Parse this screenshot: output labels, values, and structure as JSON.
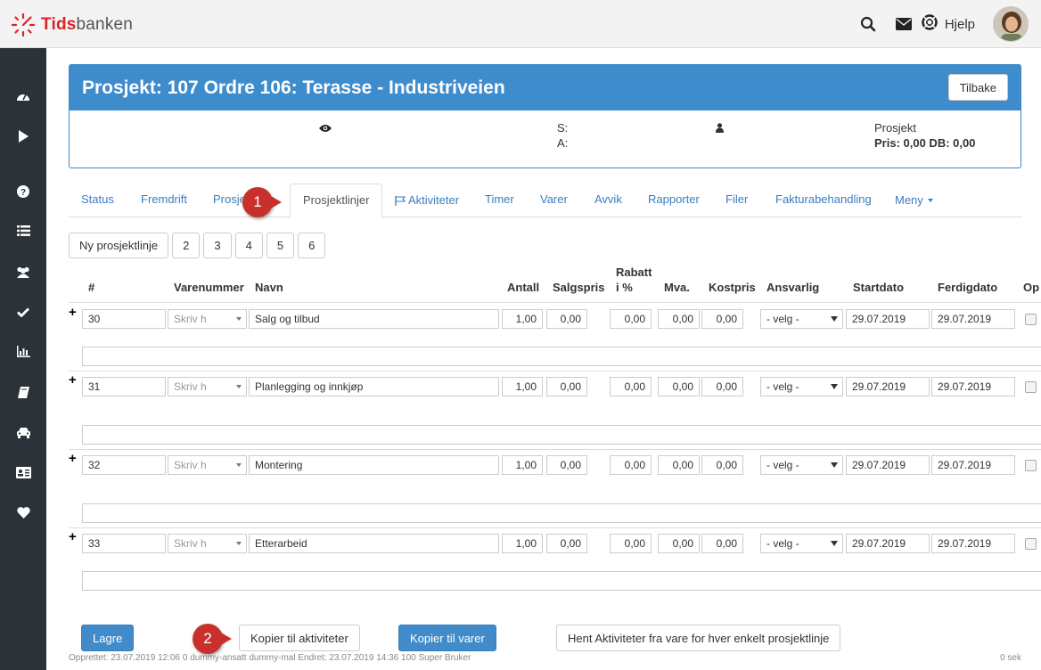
{
  "app": {
    "logo_prefix": "Tids",
    "logo_suffix": "banken"
  },
  "topbar": {
    "help_label": "Hjelp",
    "icons": [
      "search-icon",
      "mail-icon",
      "lifebuoy-icon"
    ]
  },
  "sidebar": {
    "icons": [
      "dashboard-icon",
      "play-icon",
      "help-circle-icon",
      "list-icon",
      "users-icon",
      "check-icon",
      "bar-chart-icon",
      "book-icon",
      "car-icon",
      "id-card-icon",
      "heart-icon"
    ]
  },
  "project": {
    "title": "Prosjekt: 107 Ordre 106: Terasse - Industriveien",
    "back_label": "Tilbake",
    "s_label": "S:",
    "a_label": "A:",
    "type_label": "Prosjekt",
    "price_label": "Pris: 0,00 DB: 0,00"
  },
  "tabs": [
    "Status",
    "Fremdrift",
    "Prosje",
    "Prosjektlinjer",
    "Aktiviteter",
    "Timer",
    "Varer",
    "Avvik",
    "Rapporter",
    "Filer",
    "Fakturabehandling",
    "Meny"
  ],
  "active_tab": "Prosjektlinjer",
  "subbuttons": [
    "Ny prosjektlinje",
    "2",
    "3",
    "4",
    "5",
    "6"
  ],
  "table": {
    "headers": {
      "num": "#",
      "varenummer": "Varenummer",
      "navn": "Navn",
      "antall": "Antall",
      "salgspris": "Salgspris",
      "rabatt_1": "Rabatt",
      "rabatt_2": "i %",
      "mva": "Mva.",
      "kostpris": "Kostpris",
      "ansvarlig": "Ansvarlig",
      "startdato": "Startdato",
      "ferdigdato": "Ferdigdato",
      "op": "Op"
    },
    "rows": [
      {
        "num": "30",
        "varenummer_ph": "Skriv h",
        "navn": "Salg og tilbud",
        "antall": "1,00",
        "salgspris": "0,00",
        "rabatt": "0,00",
        "mva": "0,00",
        "kostpris": "0,00",
        "ansvarlig": "- velg -",
        "startdato": "29.07.2019",
        "ferdigdato": "29.07.2019"
      },
      {
        "num": "31",
        "varenummer_ph": "Skriv h",
        "navn": "Planlegging og innkjøp",
        "antall": "1,00",
        "salgspris": "0,00",
        "rabatt": "0,00",
        "mva": "0,00",
        "kostpris": "0,00",
        "ansvarlig": "- velg -",
        "startdato": "29.07.2019",
        "ferdigdato": "29.07.2019"
      },
      {
        "num": "32",
        "varenummer_ph": "Skriv h",
        "navn": "Montering",
        "antall": "1,00",
        "salgspris": "0,00",
        "rabatt": "0,00",
        "mva": "0,00",
        "kostpris": "0,00",
        "ansvarlig": "- velg -",
        "startdato": "29.07.2019",
        "ferdigdato": "29.07.2019"
      },
      {
        "num": "33",
        "varenummer_ph": "Skriv h",
        "navn": "Etterarbeid",
        "antall": "1,00",
        "salgspris": "0,00",
        "rabatt": "0,00",
        "mva": "0,00",
        "kostpris": "0,00",
        "ansvarlig": "- velg -",
        "startdato": "29.07.2019",
        "ferdigdato": "29.07.2019"
      }
    ]
  },
  "actions": {
    "save": "Lagre",
    "copy_activities": "Kopier til aktiviteter",
    "copy_items": "Kopier til varer",
    "fetch_activities": "Hent Aktiviteter fra vare for hver enkelt prosjektlinje"
  },
  "footer": {
    "meta": "Opprettet: 23.07.2019 12:06 0 dummy-ansatt dummy-mal Endret: 23.07.2019 14:36 100 Super Bruker",
    "timing": "0 sek"
  },
  "callouts": [
    "1",
    "2"
  ],
  "colors": {
    "brand_red": "#d9232a",
    "primary_blue": "#3f8ccd",
    "sidebar": "#2b3238",
    "callout": "#c9302c"
  }
}
